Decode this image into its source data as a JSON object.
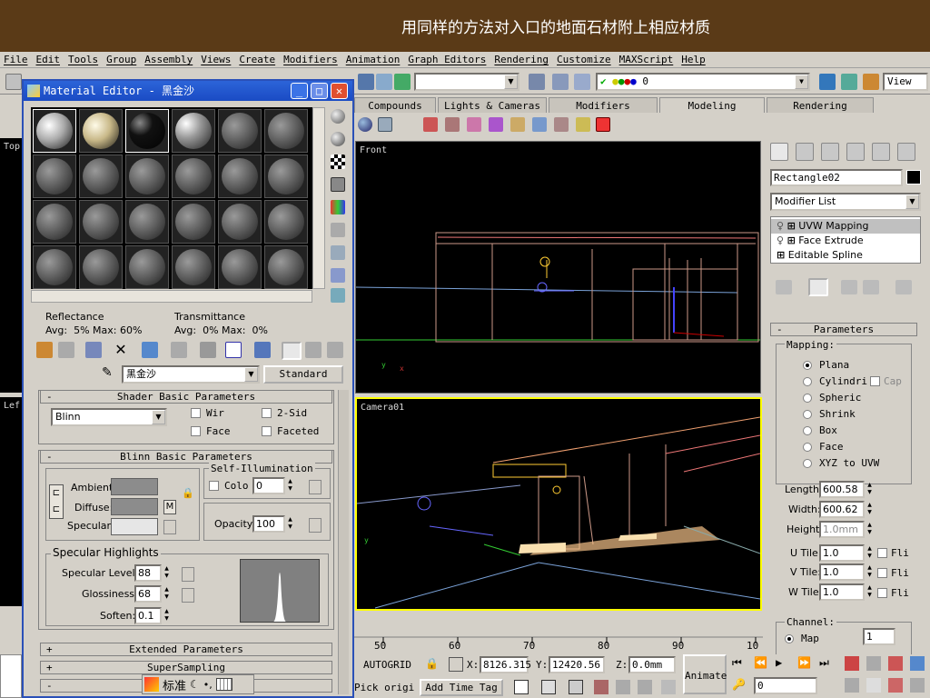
{
  "caption": "用同样的方法对入口的地面石材附上相应材质",
  "menu": [
    "File",
    "Edit",
    "Tools",
    "Group",
    "Assembly",
    "Views",
    "Create",
    "Modifiers",
    "Animation",
    "Graph Editors",
    "Rendering",
    "Customize",
    "MAXScript",
    "Help"
  ],
  "toolbar": {
    "selection_set": "",
    "layer_value": "0",
    "view_label": "View"
  },
  "tabs": [
    "Compounds",
    "Lights & Cameras",
    "Modifiers",
    "Modeling",
    "Rendering"
  ],
  "active_tab": "Modeling",
  "viewports": {
    "top_label": "Top",
    "front_label": "Front",
    "left_label": "Lef",
    "camera_label": "Camera01"
  },
  "command_panel": {
    "object_name": "Rectangle02",
    "modifier_list": "Modifier List",
    "stack": [
      "UVW Mapping",
      "Face Extrude",
      "Editable Spline"
    ],
    "parameters_title": "Parameters",
    "mapping_label": "Mapping:",
    "mapping_options": [
      "Plana",
      "Cylindri",
      "Spheric",
      "Shrink",
      "Box",
      "Face",
      "XYZ to UVW"
    ],
    "cap_label": "Cap",
    "length_label": "Length:",
    "length_value": "600.58",
    "width_label": "Width:",
    "width_value": "600.62",
    "height_label": "Height:",
    "height_value": "1.0mm",
    "utile_label": "U Tile:",
    "utile_value": "1.0",
    "vtile_label": "V Tile:",
    "vtile_value": "1.0",
    "wtile_label": "W Tile:",
    "wtile_value": "1.0",
    "flip_label": "Fli",
    "channel_label": "Channel:",
    "map_label": "Map",
    "channel_value": "1"
  },
  "material_editor": {
    "title": "Material Editor - 黑金沙",
    "reflectance_label": "Reflectance",
    "reflectance_values": "Avg:  5% Max: 60%",
    "transmittance_label": "Transmittance",
    "transmittance_values": "Avg:  0% Max:  0%",
    "material_name": "黑金沙",
    "material_type": "Standard",
    "shader_title": "Shader Basic Parameters",
    "shader_value": "Blinn",
    "wire_label": "Wir",
    "twosided_label": "2-Sid",
    "face_label": "Face",
    "faceted_label": "Faceted",
    "blinn_title": "Blinn Basic Parameters",
    "self_illum_title": "Self-Illumination",
    "color_label": "Colo",
    "self_illum_value": "0",
    "ambient_label": "Ambient:",
    "diffuse_label": "Diffuse:",
    "specular_label": "Specular:",
    "m_label": "M",
    "opacity_label": "Opacity:",
    "opacity_value": "100",
    "spec_title": "Specular Highlights",
    "spec_level_label": "Specular Level:",
    "spec_level_value": "88",
    "gloss_label": "Glossiness:",
    "gloss_value": "68",
    "soften_label": "Soften:",
    "soften_value": "0.1",
    "extended_title": "Extended Parameters",
    "supersampling_title": "SuperSampling"
  },
  "ime_label": "标准",
  "timeline": {
    "ticks": [
      "50",
      "60",
      "70",
      "80",
      "90",
      "10"
    ]
  },
  "status": {
    "autogrid": "AUTOGRID",
    "x_label": "X:",
    "x_value": "8126.315",
    "y_label": "Y:",
    "y_value": "12420.56",
    "z_label": "Z:",
    "z_value": "0.0mm",
    "pick": "Pick origi",
    "add_time_tag": "Add Time Tag",
    "animate": "Animate",
    "frame_value": "0"
  },
  "colors": {
    "caption_bg": "#5a3a17",
    "titlebar": "#1a4bc4",
    "active_viewport": "#ffff00"
  }
}
